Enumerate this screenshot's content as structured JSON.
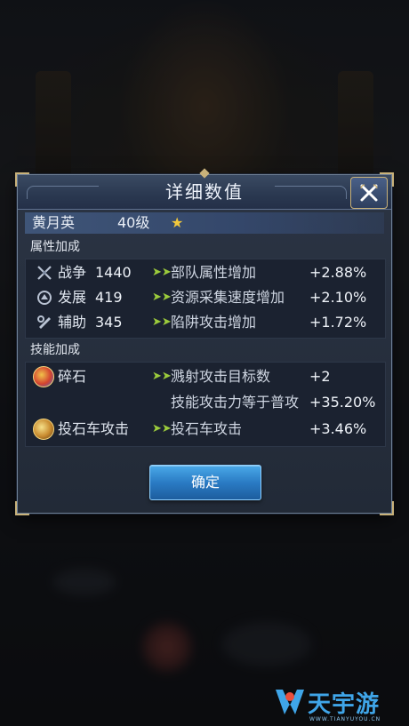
{
  "dialog": {
    "title": "详细数值",
    "ok_label": "确定"
  },
  "hero": {
    "name": "黄月英",
    "level": "40级",
    "star_icon": "star-icon"
  },
  "attributes": {
    "section_title": "属性加成",
    "rows": [
      {
        "icon": "crossed-swords-icon",
        "label": "战争",
        "value": "1440",
        "desc": "部队属性增加",
        "bonus": "+2.88%"
      },
      {
        "icon": "development-icon",
        "label": "发展",
        "value": "419",
        "desc": "资源采集速度增加",
        "bonus": "+2.10%"
      },
      {
        "icon": "assist-icon",
        "label": "辅助",
        "value": "345",
        "desc": "陷阱攻击增加",
        "bonus": "+1.72%"
      }
    ]
  },
  "skills": {
    "section_title": "技能加成",
    "rows": [
      {
        "icon": "shatter-stone-icon",
        "name": "碎石",
        "desc": "溅射攻击目标数",
        "bonus": "+2"
      },
      {
        "icon": "",
        "name": "",
        "desc": "技能攻击力等于普攻",
        "bonus": "+35.20%"
      },
      {
        "icon": "catapult-icon",
        "name": "投石车攻击",
        "desc": "投石车攻击",
        "bonus": "+3.46%"
      }
    ]
  },
  "watermark": {
    "text": "天宇游",
    "sub": "WWW.TIANYUYOU.CN"
  },
  "colors": {
    "accent_green": "#9ccc3c",
    "star": "#f2c83c",
    "button_blue": "#2a7bc4"
  }
}
